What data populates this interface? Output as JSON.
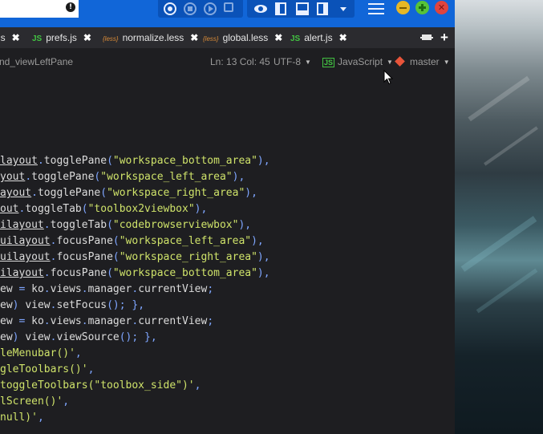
{
  "window": {
    "info_icon": "!",
    "toolbar_icons": [
      "record-icon",
      "stop-icon",
      "play-icon",
      "save-icon",
      "eye-icon",
      "layout-left-pane-icon",
      "layout-bottom-pane-icon",
      "layout-right-pane-icon",
      "dropdown-icon",
      "hamburger-menu-icon"
    ],
    "window_controls": {
      "minimize_color": "#e6b726",
      "maximize_color": "#57c23a",
      "close_color": "#e0443e"
    },
    "accent": "#1166d8"
  },
  "tabs": [
    {
      "label": "js",
      "icon": "js"
    },
    {
      "label": "prefs.js",
      "icon": "js"
    },
    {
      "label": "normalize.less",
      "icon": "less"
    },
    {
      "label": "global.less",
      "icon": "less"
    },
    {
      "label": "alert.js",
      "icon": "js"
    }
  ],
  "tab_icons": {
    "js": "JS",
    "less": "{less}"
  },
  "tab_close": "✖",
  "status": {
    "command": "nd_viewLeftPane",
    "position": "Ln: 13 Col: 45",
    "encoding": "UTF-8",
    "language": "JavaScript",
    "branch": "master"
  },
  "code": [
    [
      [
        "layout",
        "id",
        true
      ],
      [
        ".",
        "pun"
      ],
      [
        "togglePane",
        "id"
      ],
      [
        "(",
        "pun"
      ],
      [
        "\"workspace_bottom_area\"",
        "str"
      ],
      [
        "),",
        "pun"
      ]
    ],
    [
      [
        "yout",
        "id",
        true
      ],
      [
        ".",
        "pun"
      ],
      [
        "togglePane",
        "id"
      ],
      [
        "(",
        "pun"
      ],
      [
        "\"workspace_left_area\"",
        "str"
      ],
      [
        "),",
        "pun"
      ]
    ],
    [
      [
        "ayout",
        "id",
        true
      ],
      [
        ".",
        "pun"
      ],
      [
        "togglePane",
        "id"
      ],
      [
        "(",
        "pun"
      ],
      [
        "\"workspace_right_area\"",
        "str"
      ],
      [
        "),",
        "pun"
      ]
    ],
    [
      [
        "out",
        "id",
        true
      ],
      [
        ".",
        "pun"
      ],
      [
        "toggleTab",
        "id"
      ],
      [
        "(",
        "pun"
      ],
      [
        "\"toolbox2viewbox\"",
        "str"
      ],
      [
        "),",
        "pun"
      ]
    ],
    [
      [
        "ilayout",
        "id",
        true
      ],
      [
        ".",
        "pun"
      ],
      [
        "toggleTab",
        "id"
      ],
      [
        "(",
        "pun"
      ],
      [
        "\"codebrowserviewbox\"",
        "str"
      ],
      [
        "),",
        "pun"
      ]
    ],
    [
      [
        "uilayout",
        "id",
        true
      ],
      [
        ".",
        "pun"
      ],
      [
        "focusPane",
        "id"
      ],
      [
        "(",
        "pun"
      ],
      [
        "\"workspace_left_area\"",
        "str"
      ],
      [
        "),",
        "pun"
      ]
    ],
    [
      [
        "uilayout",
        "id",
        true
      ],
      [
        ".",
        "pun"
      ],
      [
        "focusPane",
        "id"
      ],
      [
        "(",
        "pun"
      ],
      [
        "\"workspace_right_area\"",
        "str"
      ],
      [
        "),",
        "pun"
      ]
    ],
    [
      [
        "ilayout",
        "id",
        true
      ],
      [
        ".",
        "pun"
      ],
      [
        "focusPane",
        "id"
      ],
      [
        "(",
        "pun"
      ],
      [
        "\"workspace_bottom_area\"",
        "str"
      ],
      [
        "),",
        "pun"
      ]
    ],
    [
      [
        "ew",
        "id"
      ],
      [
        " = ",
        "pun"
      ],
      [
        "ko",
        "id"
      ],
      [
        ".",
        "pun"
      ],
      [
        "views",
        "id"
      ],
      [
        ".",
        "pun"
      ],
      [
        "manager",
        "id"
      ],
      [
        ".",
        "pun"
      ],
      [
        "currentView",
        "id"
      ],
      [
        ";",
        "pun"
      ]
    ],
    [
      [
        "ew",
        "id"
      ],
      [
        ") ",
        "pun"
      ],
      [
        "view",
        "id"
      ],
      [
        ".",
        "pun"
      ],
      [
        "setFocus",
        "id"
      ],
      [
        "(); },",
        "pun"
      ]
    ],
    [
      [
        "ew",
        "id"
      ],
      [
        " = ",
        "pun"
      ],
      [
        "ko",
        "id"
      ],
      [
        ".",
        "pun"
      ],
      [
        "views",
        "id"
      ],
      [
        ".",
        "pun"
      ],
      [
        "manager",
        "id"
      ],
      [
        ".",
        "pun"
      ],
      [
        "currentView",
        "id"
      ],
      [
        ";",
        "pun"
      ]
    ],
    [
      [
        "ew",
        "id"
      ],
      [
        ") ",
        "pun"
      ],
      [
        "view",
        "id"
      ],
      [
        ".",
        "pun"
      ],
      [
        "viewSource",
        "id"
      ],
      [
        "(); },",
        "pun"
      ]
    ],
    [
      [
        "leMenubar()'",
        "str"
      ],
      [
        ",",
        "pun"
      ]
    ],
    [
      [
        "gleToolbars()'",
        "str"
      ],
      [
        ",",
        "pun"
      ]
    ],
    [
      [
        "toggleToolbars(\"toolbox_side\")'",
        "str"
      ],
      [
        ",",
        "pun"
      ]
    ],
    [
      [
        "lScreen()'",
        "str"
      ],
      [
        ",",
        "pun"
      ]
    ],
    [
      [
        "null)'",
        "str"
      ],
      [
        ",",
        "pun"
      ]
    ]
  ]
}
